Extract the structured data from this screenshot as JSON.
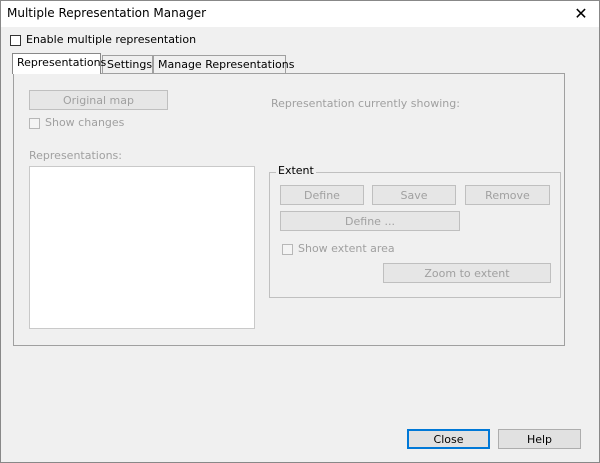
{
  "window": {
    "title": "Multiple Representation Manager",
    "close_glyph": "✕"
  },
  "enable_checkbox": {
    "label": "Enable multiple representation",
    "checked": false
  },
  "tabs": [
    {
      "label": "Representations",
      "active": true
    },
    {
      "label": "Settings",
      "active": false
    },
    {
      "label": "Manage Representations",
      "active": false
    }
  ],
  "panel": {
    "original_map_button": "Original map",
    "show_changes_label": "Show changes",
    "representation_showing_label": "Representation currently showing:",
    "representations_label": "Representations:",
    "extent": {
      "title": "Extent",
      "define_button": "Define",
      "save_button": "Save",
      "remove_button": "Remove",
      "define_more_button": "Define ...",
      "show_extent_area_label": "Show extent area",
      "zoom_to_extent_button": "Zoom to extent"
    }
  },
  "footer": {
    "close_button": "Close",
    "help_button": "Help"
  }
}
